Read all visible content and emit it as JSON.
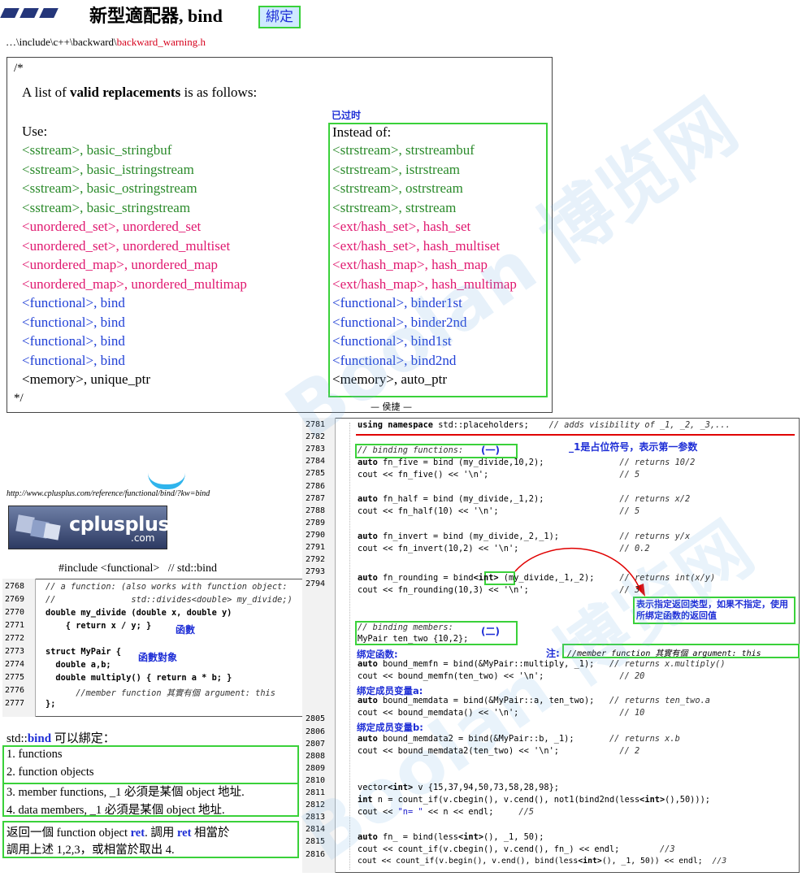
{
  "header": {
    "title": "新型適配器, bind",
    "tag": "綁定"
  },
  "path": {
    "prefix": "…\\include\\c++\\backward\\",
    "file": "backward_warning.h"
  },
  "warning_box": {
    "comment_open": "/*",
    "intro_pre": "A list of ",
    "intro_bold": "valid replacements",
    "intro_post": " is as follows:",
    "deprecated_label": "已过时",
    "use_header": "Use:",
    "instead_header": "Instead of:",
    "rows": [
      {
        "use": "<sstream>, basic_stringbuf",
        "instead": "<strstream>, strstreambuf"
      },
      {
        "use": "<sstream>, basic_istringstream",
        "instead": "<strstream>, istrstream"
      },
      {
        "use": "<sstream>, basic_ostringstream",
        "instead": "<strstream>, ostrstream"
      },
      {
        "use": "<sstream>, basic_stringstream",
        "instead": "<strstream>, strstream"
      },
      {
        "use": "<unordered_set>, unordered_set",
        "instead": "<ext/hash_set>, hash_set"
      },
      {
        "use": "<unordered_set>, unordered_multiset",
        "instead": "<ext/hash_set>, hash_multiset"
      },
      {
        "use": "<unordered_map>, unordered_map",
        "instead": "<ext/hash_map>, hash_map"
      },
      {
        "use": "<unordered_map>, unordered_multimap",
        "instead": "<ext/hash_map>, hash_multimap"
      },
      {
        "use": "<functional>, bind",
        "instead": "<functional>, binder1st"
      },
      {
        "use": "<functional>, bind",
        "instead": "<functional>, binder2nd"
      },
      {
        "use": "<functional>, bind",
        "instead": "<functional>, bind1st"
      },
      {
        "use": "<functional>, bind",
        "instead": "<functional>, bind2nd"
      },
      {
        "use": "<memory>, unique_ptr",
        "instead": "<memory>, auto_ptr"
      }
    ],
    "comment_close": "*/",
    "signature": "— 侯捷 —"
  },
  "reference": {
    "url": "http://www.cplusplus.com/reference/functional/bind/?kw=bind",
    "logo_text": "cplusplus",
    "logo_sub": ".com",
    "include_line": "#include <functional>   // std::bind"
  },
  "left_code": {
    "lines": [
      {
        "n": "2768",
        "t": "// a function: (also works with function object:"
      },
      {
        "n": "2769",
        "t": "//               std::divides<double> my_divide;)"
      },
      {
        "n": "2770",
        "t": "double my_divide (double x, double y)"
      },
      {
        "n": "2771",
        "t": "    { return x / y; }"
      },
      {
        "n": "2772",
        "t": ""
      },
      {
        "n": "2773",
        "t": "struct MyPair {"
      },
      {
        "n": "2774",
        "t": "  double a,b;"
      },
      {
        "n": "2775",
        "t": "  double multiply() { return a * b; }"
      },
      {
        "n": "2776",
        "t": "      //member function 其實有個 argument: this"
      },
      {
        "n": "2777",
        "t": "};"
      }
    ],
    "annot_function": "函數",
    "annot_functor": "函數對象"
  },
  "bindable": {
    "heading_pre": "std::",
    "heading_bold": "bind",
    "heading_post": " 可以綁定：",
    "items": [
      "1. functions",
      "2. function objects",
      "3. member functions, _1 必須是某個 object 地址.",
      "4. data members, _1 必須是某個 object 地址."
    ],
    "return_pre": "返回一個 function object ",
    "return_bold1": "ret",
    "return_mid": ". 調用 ",
    "return_bold2": "ret",
    "return_post": " 相當於",
    "return_line2": "調用上述 1,2,3，或相當於取出 4."
  },
  "right_code": {
    "line_numbers": [
      "2781",
      "2782",
      "2783",
      "2784",
      "2785",
      "2786",
      "2787",
      "2788",
      "2789",
      "2790",
      "2791",
      "2792",
      "2793",
      "2794",
      "",
      "",
      "",
      "",
      "",
      "",
      "",
      "",
      "",
      "",
      "2805",
      "2806",
      "2807",
      "2808",
      "2809",
      "2810",
      "2811",
      "2812",
      "2813",
      "2814",
      "2815",
      "2816"
    ],
    "annotations": {
      "placeholder_note": "_1是占位符号，表示第一参数",
      "group_one": "(一)",
      "group_two": "(二)",
      "return_type_note": "表示指定返回类型，如果不指定，使用所绑定函数的返回值",
      "bind_function": "绑定函数:",
      "bind_member_a": "绑定成员变量a:",
      "bind_member_b": "绑定成员变量b:",
      "note_label": "注:",
      "note_text": "//member function 其實有個 argument: this"
    }
  }
}
